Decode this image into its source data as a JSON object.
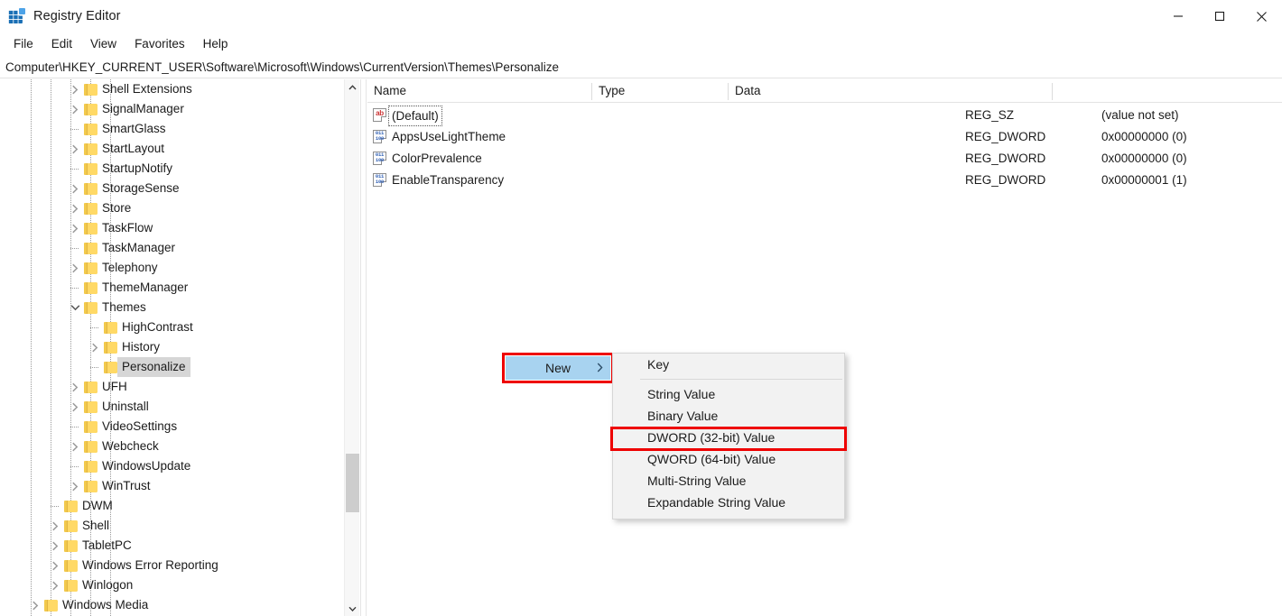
{
  "window": {
    "title": "Registry Editor",
    "icon": "registry-editor-icon",
    "controls": {
      "minimize": "minimize-icon",
      "maximize": "maximize-icon",
      "close": "close-icon"
    }
  },
  "menubar": {
    "items": [
      {
        "label": "File"
      },
      {
        "label": "Edit"
      },
      {
        "label": "View"
      },
      {
        "label": "Favorites"
      },
      {
        "label": "Help"
      }
    ]
  },
  "address": {
    "path": "Computer\\HKEY_CURRENT_USER\\Software\\Microsoft\\Windows\\CurrentVersion\\Themes\\Personalize"
  },
  "tree": {
    "items": [
      {
        "label": "Shell Extensions",
        "depth": 4,
        "expander": "collapsed",
        "selected": false
      },
      {
        "label": "SignalManager",
        "depth": 4,
        "expander": "collapsed",
        "selected": false
      },
      {
        "label": "SmartGlass",
        "depth": 4,
        "expander": "none",
        "selected": false
      },
      {
        "label": "StartLayout",
        "depth": 4,
        "expander": "collapsed",
        "selected": false
      },
      {
        "label": "StartupNotify",
        "depth": 4,
        "expander": "none",
        "selected": false
      },
      {
        "label": "StorageSense",
        "depth": 4,
        "expander": "collapsed",
        "selected": false
      },
      {
        "label": "Store",
        "depth": 4,
        "expander": "collapsed",
        "selected": false
      },
      {
        "label": "TaskFlow",
        "depth": 4,
        "expander": "collapsed",
        "selected": false
      },
      {
        "label": "TaskManager",
        "depth": 4,
        "expander": "none",
        "selected": false
      },
      {
        "label": "Telephony",
        "depth": 4,
        "expander": "collapsed",
        "selected": false
      },
      {
        "label": "ThemeManager",
        "depth": 4,
        "expander": "none",
        "selected": false
      },
      {
        "label": "Themes",
        "depth": 4,
        "expander": "expanded",
        "selected": false
      },
      {
        "label": "HighContrast",
        "depth": 5,
        "expander": "none",
        "selected": false
      },
      {
        "label": "History",
        "depth": 5,
        "expander": "collapsed",
        "selected": false
      },
      {
        "label": "Personalize",
        "depth": 5,
        "expander": "none",
        "selected": true
      },
      {
        "label": "UFH",
        "depth": 4,
        "expander": "collapsed",
        "selected": false
      },
      {
        "label": "Uninstall",
        "depth": 4,
        "expander": "collapsed",
        "selected": false
      },
      {
        "label": "VideoSettings",
        "depth": 4,
        "expander": "none",
        "selected": false
      },
      {
        "label": "Webcheck",
        "depth": 4,
        "expander": "collapsed",
        "selected": false
      },
      {
        "label": "WindowsUpdate",
        "depth": 4,
        "expander": "none",
        "selected": false
      },
      {
        "label": "WinTrust",
        "depth": 4,
        "expander": "collapsed",
        "selected": false
      },
      {
        "label": "DWM",
        "depth": 3,
        "expander": "none",
        "selected": false
      },
      {
        "label": "Shell",
        "depth": 3,
        "expander": "collapsed",
        "selected": false
      },
      {
        "label": "TabletPC",
        "depth": 3,
        "expander": "collapsed",
        "selected": false
      },
      {
        "label": "Windows Error Reporting",
        "depth": 3,
        "expander": "collapsed",
        "selected": false
      },
      {
        "label": "Winlogon",
        "depth": 3,
        "expander": "collapsed",
        "selected": false
      },
      {
        "label": "Windows Media",
        "depth": 2,
        "expander": "collapsed",
        "selected": false
      }
    ],
    "scrollbar": {
      "up": "chevron-up-icon",
      "down": "chevron-down-icon"
    }
  },
  "list": {
    "columns": [
      {
        "label": "Name"
      },
      {
        "label": "Type"
      },
      {
        "label": "Data"
      }
    ],
    "rows": [
      {
        "name": "(Default)",
        "type": "REG_SZ",
        "data": "(value not set)",
        "icon": "string-value-icon",
        "focused": true
      },
      {
        "name": "AppsUseLightTheme",
        "type": "REG_DWORD",
        "data": "0x00000000 (0)",
        "icon": "dword-value-icon",
        "focused": false
      },
      {
        "name": "ColorPrevalence",
        "type": "REG_DWORD",
        "data": "0x00000000 (0)",
        "icon": "dword-value-icon",
        "focused": false
      },
      {
        "name": "EnableTransparency",
        "type": "REG_DWORD",
        "data": "0x00000001 (1)",
        "icon": "dword-value-icon",
        "focused": false
      }
    ]
  },
  "context_menu": {
    "parent": {
      "label": "New",
      "submenu_arrow": "chevron-right-icon",
      "highlighted": true
    },
    "items": [
      {
        "label": "Key",
        "separator_after": true,
        "highlighted": false
      },
      {
        "label": "String Value",
        "separator_after": false,
        "highlighted": false
      },
      {
        "label": "Binary Value",
        "separator_after": false,
        "highlighted": false
      },
      {
        "label": "DWORD (32-bit) Value",
        "separator_after": false,
        "highlighted": true
      },
      {
        "label": "QWORD (64-bit) Value",
        "separator_after": false,
        "highlighted": false
      },
      {
        "label": "Multi-String Value",
        "separator_after": false,
        "highlighted": false
      },
      {
        "label": "Expandable String Value",
        "separator_after": false,
        "highlighted": false
      }
    ]
  },
  "colors": {
    "annotation_red": "#ee0000",
    "menu_highlight_blue": "#a8d3f0",
    "tree_selection_gray": "#d6d6d6",
    "folder_yellow": "#ffd966"
  }
}
